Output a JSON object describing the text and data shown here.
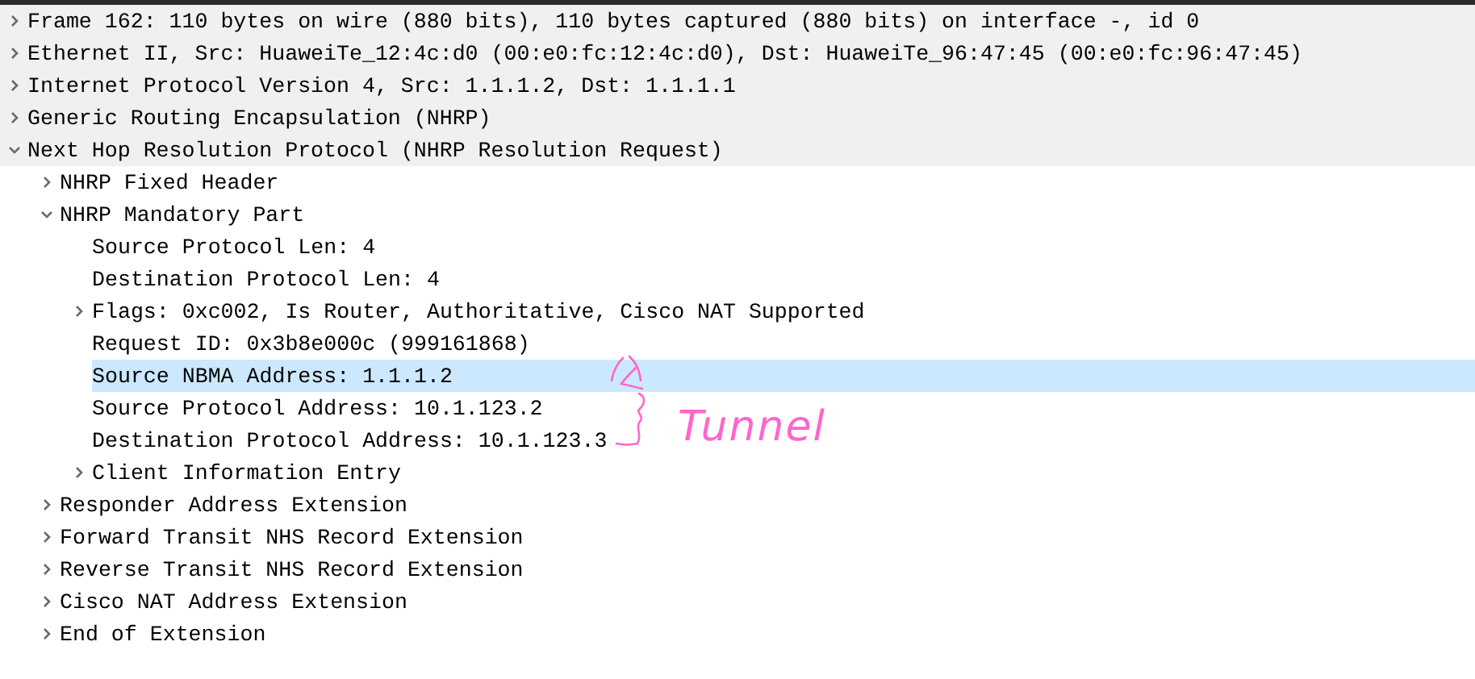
{
  "tree": [
    {
      "label": "Frame 162: 110 bytes on wire (880 bits), 110 bytes captured (880 bits) on interface -, id 0",
      "expanded": false,
      "selected": false
    },
    {
      "label": "Ethernet II, Src: HuaweiTe_12:4c:d0 (00:e0:fc:12:4c:d0), Dst: HuaweiTe_96:47:45 (00:e0:fc:96:47:45)",
      "expanded": false,
      "selected": false
    },
    {
      "label": "Internet Protocol Version 4, Src: 1.1.1.2, Dst: 1.1.1.1",
      "expanded": false,
      "selected": false
    },
    {
      "label": "Generic Routing Encapsulation (NHRP)",
      "expanded": false,
      "selected": false
    },
    {
      "label": "Next Hop Resolution Protocol (NHRP Resolution Request)",
      "expanded": true,
      "selected": false,
      "children": [
        {
          "label": "NHRP Fixed Header",
          "expanded": false,
          "selected": false
        },
        {
          "label": "NHRP Mandatory Part",
          "expanded": true,
          "selected": false,
          "children": [
            {
              "label": "Source Protocol Len: 4",
              "selected": false
            },
            {
              "label": "Destination Protocol Len: 4",
              "selected": false
            },
            {
              "label": "Flags: 0xc002, Is Router, Authoritative, Cisco NAT Supported",
              "expanded": false,
              "selected": false
            },
            {
              "label": "Request ID: 0x3b8e000c (999161868)",
              "selected": false
            },
            {
              "label": "Source NBMA Address: 1.1.1.2",
              "selected": true
            },
            {
              "label": "Source Protocol Address: 10.1.123.2",
              "selected": false
            },
            {
              "label": "Destination Protocol Address: 10.1.123.3",
              "selected": false
            },
            {
              "label": "Client Information Entry",
              "expanded": false,
              "selected": false
            }
          ]
        },
        {
          "label": "Responder Address Extension",
          "expanded": false,
          "selected": false
        },
        {
          "label": "Forward Transit NHS Record Extension",
          "expanded": false,
          "selected": false
        },
        {
          "label": "Reverse Transit NHS Record Extension",
          "expanded": false,
          "selected": false
        },
        {
          "label": "Cisco NAT Address Extension",
          "expanded": false,
          "selected": false
        },
        {
          "label": "End of Extension",
          "expanded": false,
          "selected": false
        }
      ]
    }
  ],
  "annotation": {
    "text": "Tunnel",
    "color": "#ff66cc"
  }
}
